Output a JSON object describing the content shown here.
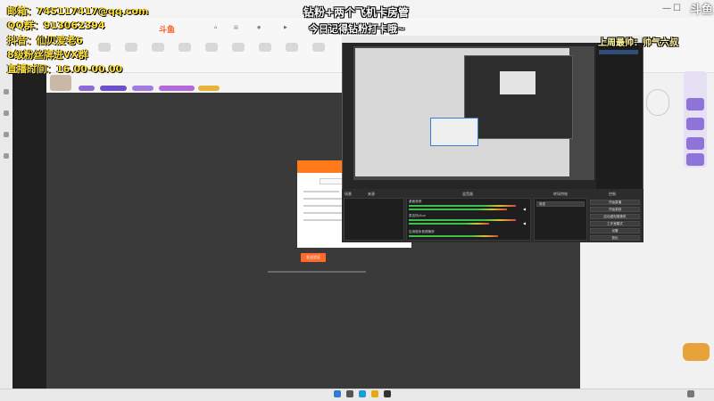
{
  "overlay": {
    "left_lines": [
      "邮箱：745117417@qq.com",
      "QQ群：913062394",
      "抖音：仙贝爱老6",
      "8级粉丝牌进VX群",
      "直播时间：16.00-00.00"
    ],
    "top_banner_1": "钻粉+两个飞机卡房管",
    "top_banner_2": "今日记得钻粉打卡哦~",
    "right_banner": "上周最帅：帅气六叔"
  },
  "platform": {
    "logo": "斗鱼",
    "sub": "DOUYU.COM",
    "site_logo": "斗鱼"
  },
  "obs": {
    "scenes_header": "场景",
    "sources_header": "来源",
    "mixer_header": "混音器",
    "transitions_header": "转场特效",
    "controls_header": "控制",
    "controls": [
      "开始直播",
      "开始录制",
      "启动虚拟摄像机",
      "工作室模式",
      "设置",
      "退出"
    ],
    "transition_value": "渐变",
    "audio_channels": [
      "桌面音频",
      "麦克风/Aux",
      "应用程序音频捕获"
    ]
  },
  "dialog": {
    "primary_button": "发送验证"
  },
  "colors": {
    "accent_orange": "#ff6a2a",
    "overlay_yellow": "#ffe13a",
    "obs_dark": "#262626"
  }
}
